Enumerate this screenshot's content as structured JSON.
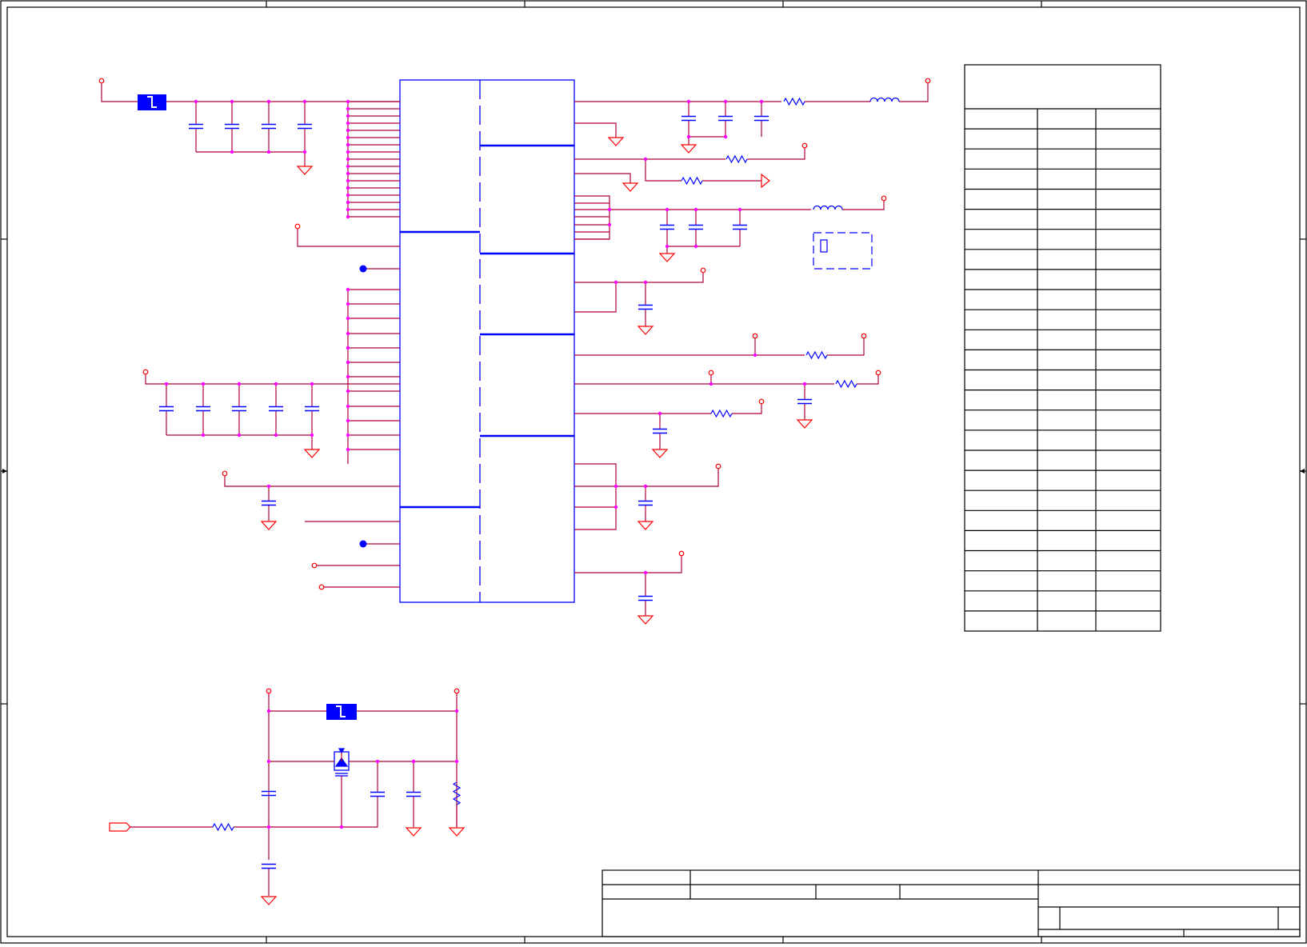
{
  "sheet": {
    "title_block_text": "",
    "pin_table_title": ""
  },
  "colors": {
    "border": "#000000",
    "wire": "#b0003a",
    "component": "#0000ff",
    "junction": "#ff00ff",
    "power_port": "#ff0000",
    "ground": "#ff0000",
    "background": "#ffffff"
  },
  "pin_table": {
    "rows": 23,
    "columns": 3
  }
}
